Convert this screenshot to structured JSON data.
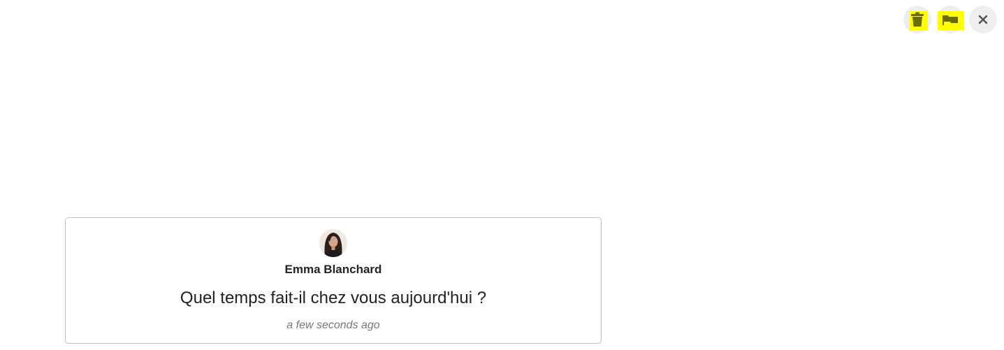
{
  "toolbar": {
    "buttons": [
      {
        "icon": "trash-icon",
        "highlight_color": "#ffff00"
      },
      {
        "icon": "flag-icon",
        "highlight_color": "#ffff00"
      },
      {
        "icon": "close-icon",
        "glyph": "✕"
      }
    ]
  },
  "message_card": {
    "author": "Emma Blanchard",
    "text": "Quel temps fait-il chez vous aujourd'hui ?",
    "timestamp": "a few seconds ago"
  },
  "colors": {
    "highlight": "#ffff00",
    "icon": "#6b6b00",
    "button_bg": "#eeeeee",
    "card_border": "#bdbdbd",
    "text": "#222222",
    "muted_text": "#777777"
  }
}
